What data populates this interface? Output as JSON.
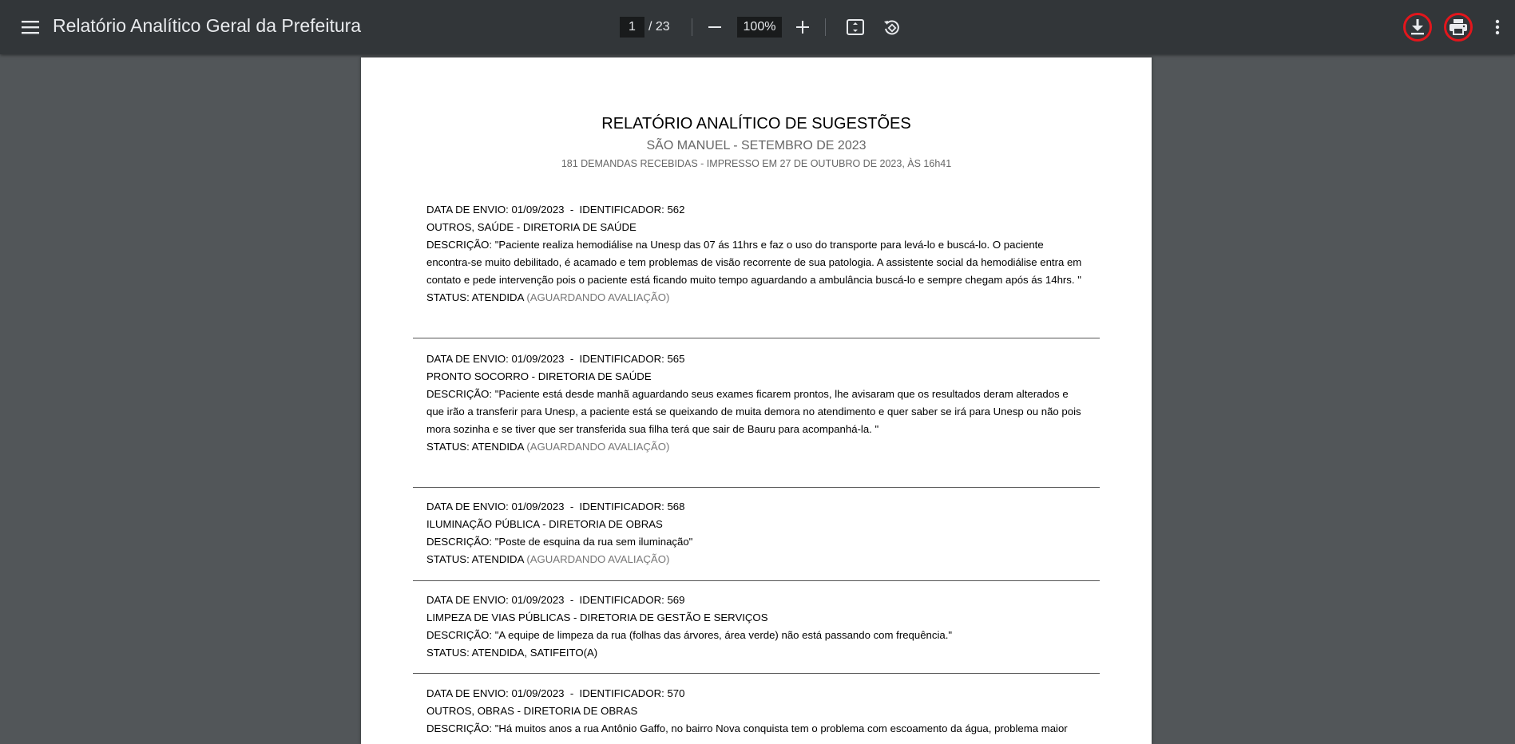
{
  "toolbar": {
    "title": "Relatório Analítico Geral da Prefeitura",
    "page_current": "1",
    "page_total": "/ 23",
    "zoom": "100%",
    "icons": [
      "menu-icon",
      "minus-icon",
      "plus-icon",
      "fit-page-icon",
      "rotate-icon",
      "download-icon",
      "print-icon",
      "more-vertical-icon"
    ],
    "highlight_color": "#e3161c"
  },
  "report": {
    "title": "RELATÓRIO ANALÍTICO DE SUGESTÕES",
    "subtitle": "SÃO MANUEL - SETEMBRO DE 2023",
    "meta": "181 DEMANDAS RECEBIDAS - IMPRESSO EM 27 DE OUTUBRO DE 2023, ÀS 16h41",
    "entries": [
      {
        "header": "DATA DE ENVIO: 01/09/2023  -  IDENTIFICADOR: 562",
        "category": "OUTROS, SAÚDE - DIRETORIA DE SAÚDE",
        "description": "DESCRIÇÃO: \"Paciente realiza hemodiálise na Unesp das 07 ás 11hrs e faz o uso do transporte para levá-lo e buscá-lo. O paciente encontra-se muito debilitado, é acamado e tem problemas de visão recorrente de sua patologia. A assistente social da hemodiálise entra em contato e pede intervenção pois o paciente está ficando muito tempo aguardando a ambulância buscá-lo e sempre chegam após ás 14hrs. \"",
        "status": "STATUS: ATENDIDA",
        "status_note": "(AGUARDANDO AVALIAÇÃO)"
      },
      {
        "header": "DATA DE ENVIO: 01/09/2023  -  IDENTIFICADOR: 565",
        "category": "PRONTO SOCORRO - DIRETORIA DE SAÚDE",
        "description": "DESCRIÇÃO: \"Paciente está desde manhã aguardando seus exames ficarem prontos, lhe avisaram que os resultados deram alterados e que irão a transferir para Unesp, a paciente está se queixando de muita demora no atendimento e quer saber se irá para Unesp ou não pois mora sozinha e se tiver que ser transferida sua filha terá que sair de Bauru para acompanhá-la. \"",
        "status": "STATUS: ATENDIDA",
        "status_note": "(AGUARDANDO AVALIAÇÃO)"
      },
      {
        "header": "DATA DE ENVIO: 01/09/2023  -  IDENTIFICADOR: 568",
        "category": "ILUMINAÇÃO PÚBLICA - DIRETORIA DE OBRAS",
        "description": "DESCRIÇÃO: \"Poste de esquina da rua sem iluminação\"",
        "status": "STATUS: ATENDIDA",
        "status_note": "(AGUARDANDO AVALIAÇÃO)"
      },
      {
        "header": "DATA DE ENVIO: 01/09/2023  -  IDENTIFICADOR: 569",
        "category": "LIMPEZA DE VIAS PÚBLICAS - DIRETORIA DE GESTÃO E SERVIÇOS",
        "description": "DESCRIÇÃO: \"A equipe de limpeza da rua (folhas das árvores, área verde) não está passando com frequência.\"",
        "status": "STATUS: ATENDIDA, SATIFEITO(A)",
        "status_note": ""
      },
      {
        "header": "DATA DE ENVIO: 01/09/2023  -  IDENTIFICADOR: 570",
        "category": "OUTROS, OBRAS - DIRETORIA DE OBRAS",
        "description": "DESCRIÇÃO: \"Há muitos anos a rua Antônio Gaffo, no bairro Nova conquista tem o problema com escoamento da água, problema maior",
        "status": "",
        "status_note": ""
      }
    ]
  }
}
